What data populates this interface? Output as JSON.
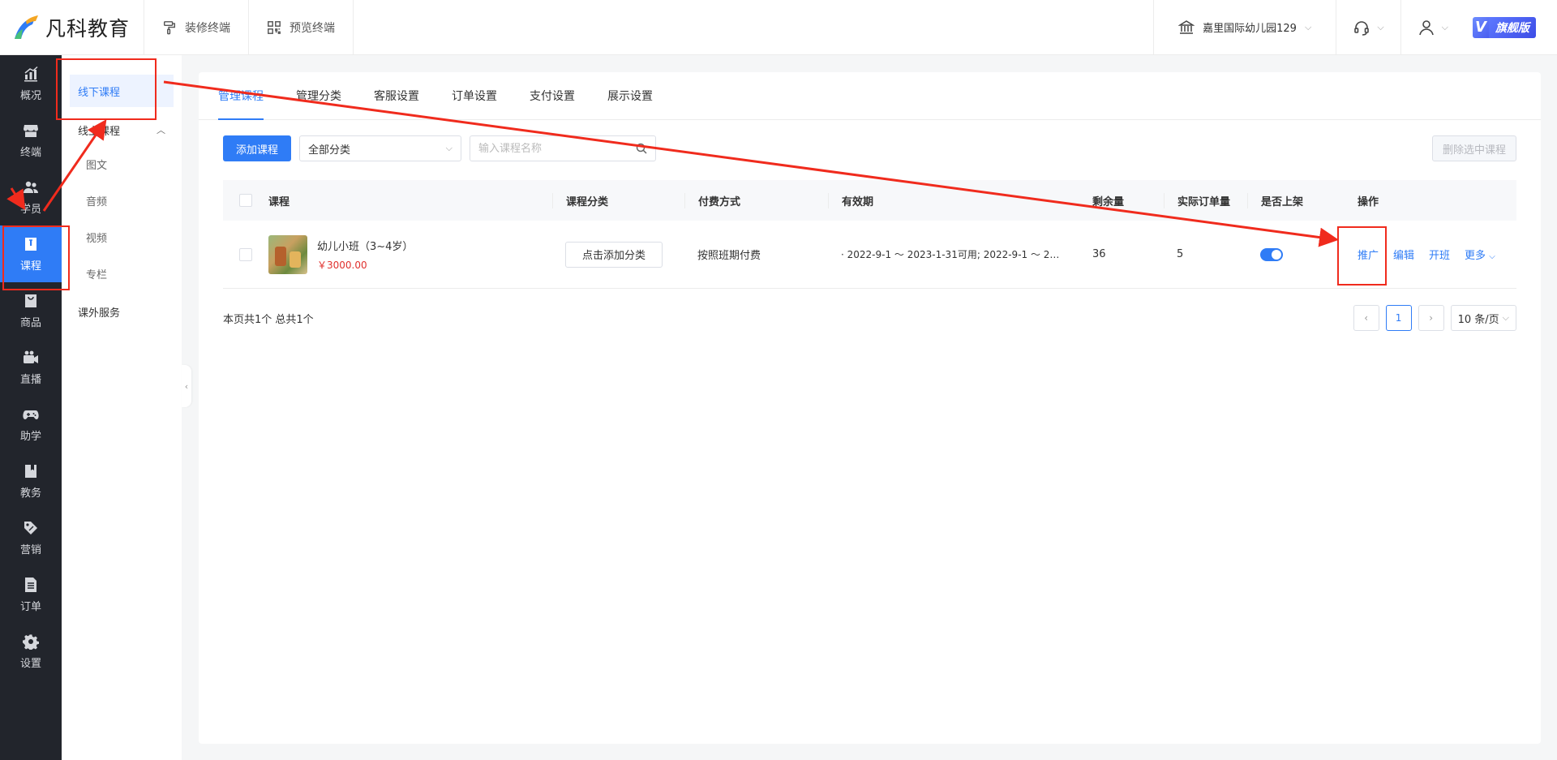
{
  "header": {
    "logo_text": "凡科教育",
    "tools": [
      {
        "label": "装修终端",
        "icon": "paint-roller-icon"
      },
      {
        "label": "预览终端",
        "icon": "qrcode-icon"
      }
    ],
    "school_name": "嘉里国际幼儿园129",
    "vip_v": "V",
    "vip_label": "旗舰版"
  },
  "sidebar": {
    "items": [
      {
        "label": "概况",
        "icon": "chart-icon"
      },
      {
        "label": "终端",
        "icon": "store-icon"
      },
      {
        "label": "学员",
        "icon": "users-icon"
      },
      {
        "label": "课程",
        "icon": "book-icon",
        "active": true
      },
      {
        "label": "商品",
        "icon": "bag-icon"
      },
      {
        "label": "直播",
        "icon": "video-icon"
      },
      {
        "label": "助学",
        "icon": "gamepad-icon"
      },
      {
        "label": "教务",
        "icon": "notebook-icon"
      },
      {
        "label": "营销",
        "icon": "tag-icon"
      },
      {
        "label": "订单",
        "icon": "document-icon"
      },
      {
        "label": "设置",
        "icon": "gear-icon"
      }
    ]
  },
  "submenu": {
    "offline": "线下课程",
    "online": "线上课程",
    "online_children": [
      "图文",
      "音频",
      "视频",
      "专栏"
    ],
    "extra": "课外服务"
  },
  "tabs": [
    "管理课程",
    "管理分类",
    "客服设置",
    "订单设置",
    "支付设置",
    "展示设置"
  ],
  "toolbar": {
    "add_label": "添加课程",
    "category_value": "全部分类",
    "search_placeholder": "输入课程名称",
    "delete_label": "删除选中课程"
  },
  "table": {
    "headers": {
      "course": "课程",
      "category": "课程分类",
      "pay": "付费方式",
      "valid": "有效期",
      "remain": "剩余量",
      "orders": "实际订单量",
      "onsale": "是否上架",
      "ops": "操作"
    },
    "rows": [
      {
        "name": "幼儿小班（3~4岁）",
        "price": "￥3000.00",
        "category_btn": "点击添加分类",
        "pay": "按照班期付费",
        "valid": "· 2022-9-1 ～ 2023-1-31可用; 2022-9-1 ～ 202...",
        "remain": "36",
        "orders": "5",
        "onsale": true,
        "ops": {
          "promote": "推广",
          "edit": "编辑",
          "open": "开班",
          "more": "更多"
        }
      }
    ]
  },
  "footer": {
    "page_info": "本页共1个 总共1个",
    "current_page": "1",
    "page_size": "10 条/页"
  },
  "colors": {
    "primary": "#2f7cf6",
    "annotation": "#f02b1d",
    "sidebar_bg": "#22252c",
    "price": "#e0302d"
  }
}
